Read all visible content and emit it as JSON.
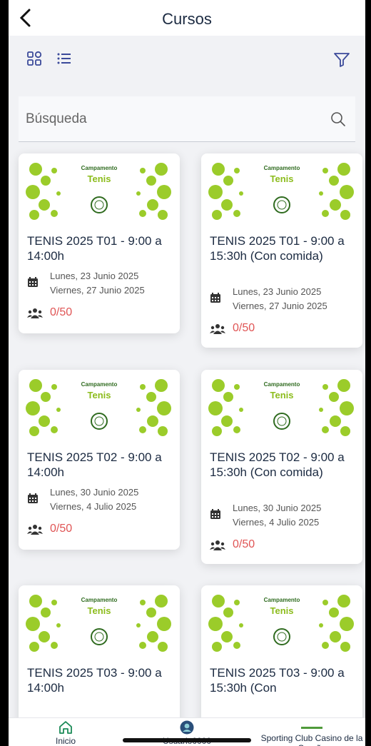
{
  "header": {
    "title": "Cursos"
  },
  "search": {
    "placeholder": "Búsqueda"
  },
  "courses": [
    {
      "image_label": "Campamento",
      "image_title": "Tenis",
      "title": "TENIS 2025 T01 - 9:00 a 14:00h",
      "start": "Lunes, 23 Junio 2025",
      "end": "Viernes, 27 Junio 2025",
      "capacity": "0/50"
    },
    {
      "image_label": "Campamento",
      "image_title": "Tenis",
      "title": "TENIS 2025 T01 - 9:00 a 15:30h (Con comida)",
      "start": "Lunes, 23 Junio 2025",
      "end": "Viernes, 27 Junio 2025",
      "capacity": "0/50"
    },
    {
      "image_label": "Campamento",
      "image_title": "Tenis",
      "title": "TENIS 2025 T02 - 9:00 a 14:00h",
      "start": "Lunes, 30 Junio 2025",
      "end": "Viernes, 4 Julio 2025",
      "capacity": "0/50"
    },
    {
      "image_label": "Campamento",
      "image_title": "Tenis",
      "title": "TENIS 2025 T02 - 9:00 a 15:30h (Con comida)",
      "start": "Lunes, 30 Junio 2025",
      "end": "Viernes, 4 Julio 2025",
      "capacity": "0/50"
    },
    {
      "image_label": "Campamento",
      "image_title": "Tenis",
      "title": "TENIS 2025 T03 - 9:00 a 14:00h"
    },
    {
      "image_label": "Campamento",
      "image_title": "Tenis",
      "title": "TENIS 2025 T03 - 9:00 a 15:30h (Con"
    }
  ],
  "tabbar": {
    "home_label": "Inicio",
    "user_label": "Usuario0000",
    "club_label": "Sporting Club Casino de la Coruña"
  },
  "colors": {
    "accent": "#8cbc1c",
    "capacity": "#e05555",
    "title": "#1b2a41"
  }
}
